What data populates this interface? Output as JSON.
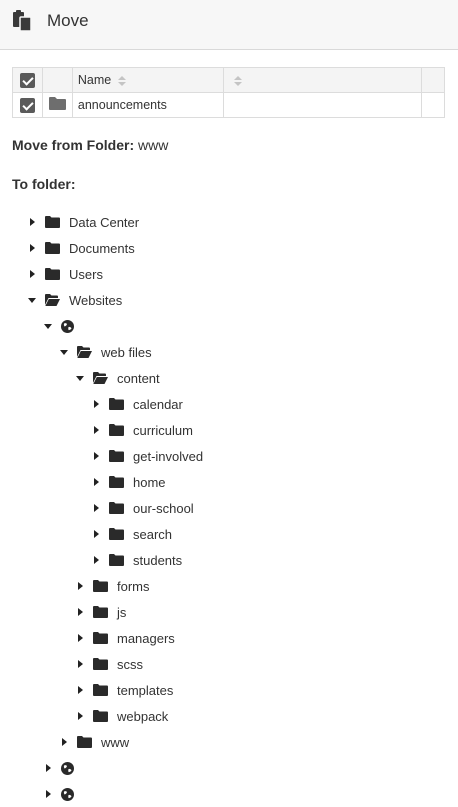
{
  "header": {
    "title": "Move",
    "icon": "clipboard-icon"
  },
  "table": {
    "columns": [
      {
        "label": ""
      },
      {
        "label": ""
      },
      {
        "label": "Name"
      },
      {
        "label": ""
      },
      {
        "label": ""
      }
    ],
    "rows": [
      {
        "checked": true,
        "icon": "folder-icon",
        "name": "announcements"
      }
    ]
  },
  "move_from": {
    "label": "Move from Folder:",
    "value": "www"
  },
  "to_folder": {
    "label": "To folder:"
  },
  "tree": [
    {
      "label": "Data Center",
      "depth": 0,
      "expanded": false,
      "type": "folder"
    },
    {
      "label": "Documents",
      "depth": 0,
      "expanded": false,
      "type": "folder"
    },
    {
      "label": "Users",
      "depth": 0,
      "expanded": false,
      "type": "folder"
    },
    {
      "label": "Websites",
      "depth": 0,
      "expanded": true,
      "type": "folder"
    },
    {
      "label": "",
      "depth": 1,
      "expanded": true,
      "type": "globe"
    },
    {
      "label": "web files",
      "depth": 2,
      "expanded": true,
      "type": "folder"
    },
    {
      "label": "content",
      "depth": 3,
      "expanded": true,
      "type": "folder"
    },
    {
      "label": "calendar",
      "depth": 4,
      "expanded": false,
      "type": "folder"
    },
    {
      "label": "curriculum",
      "depth": 4,
      "expanded": false,
      "type": "folder"
    },
    {
      "label": "get-involved",
      "depth": 4,
      "expanded": false,
      "type": "folder"
    },
    {
      "label": "home",
      "depth": 4,
      "expanded": false,
      "type": "folder"
    },
    {
      "label": "our-school",
      "depth": 4,
      "expanded": false,
      "type": "folder"
    },
    {
      "label": "search",
      "depth": 4,
      "expanded": false,
      "type": "folder"
    },
    {
      "label": "students",
      "depth": 4,
      "expanded": false,
      "type": "folder"
    },
    {
      "label": "forms",
      "depth": 3,
      "expanded": false,
      "type": "folder"
    },
    {
      "label": "js",
      "depth": 3,
      "expanded": false,
      "type": "folder"
    },
    {
      "label": "managers",
      "depth": 3,
      "expanded": false,
      "type": "folder"
    },
    {
      "label": "scss",
      "depth": 3,
      "expanded": false,
      "type": "folder"
    },
    {
      "label": "templates",
      "depth": 3,
      "expanded": false,
      "type": "folder"
    },
    {
      "label": "webpack",
      "depth": 3,
      "expanded": false,
      "type": "folder"
    },
    {
      "label": "www",
      "depth": 2,
      "expanded": false,
      "type": "folder"
    },
    {
      "label": "",
      "depth": 1,
      "expanded": false,
      "type": "globe"
    },
    {
      "label": "",
      "depth": 1,
      "expanded": false,
      "type": "globe"
    }
  ]
}
